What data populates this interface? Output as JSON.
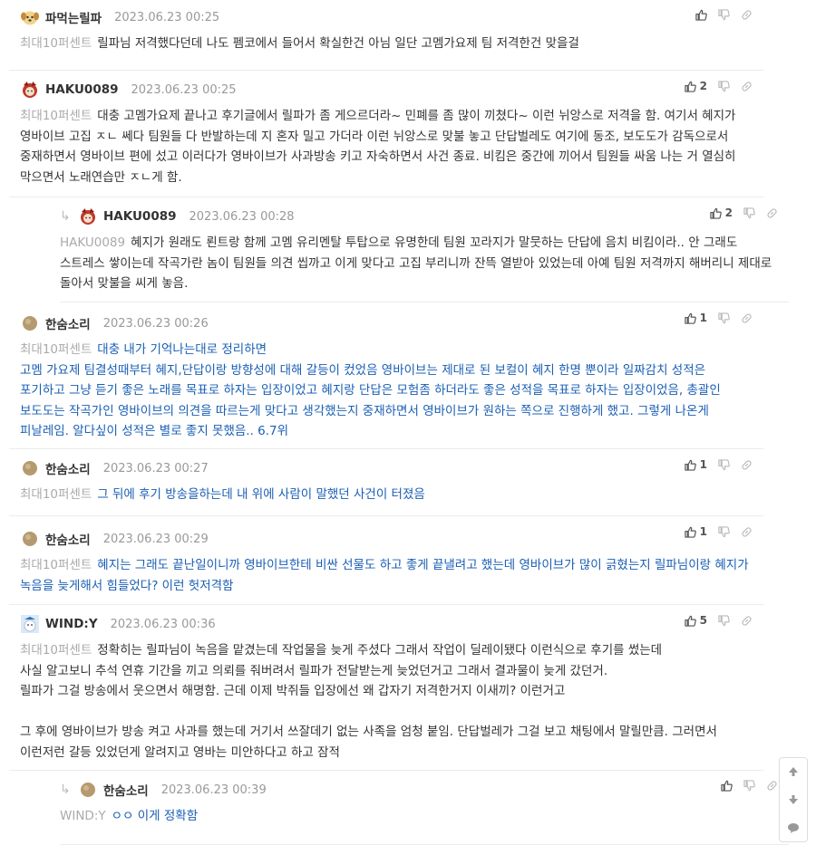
{
  "comments": [
    {
      "nick": "파먹는릴파",
      "date": "2023.06.23 00:25",
      "avatar": "dog-face-icon",
      "likes": "",
      "mention": "최대10퍼센트",
      "text": "릴파님 저격했다던데 나도 펨코에서 들어서 확실한건 아님 일단 고멤가요제 팀 저격한건 맞을걸",
      "blue": false,
      "reply": false
    },
    {
      "nick": "HAKU0089",
      "date": "2023.06.23 00:25",
      "avatar": "red-character-icon",
      "likes": "2",
      "mention": "최대10퍼센트",
      "text": "대충 고멤가요제 끝나고 후기글에서 릴파가 좀 게으르더라~ 민폐를 좀 많이 끼쳤다~ 이런 뉘앙스로 저격을 함. 여기서 혜지가 영바이브 고집 ㅈㄴ 쎄다 팀원들 다 반발하는데 지 혼자 밀고 가더라 이런 뉘앙스로 맞불 놓고 단답벌레도 여기에 동조, 보도도가 감독으로서 중재하면서 영바이브 편에 섰고 이러다가 영바이브가 사과방송 키고 자숙하면서 사건 종료. 비킴은 중간에 끼어서 팀원들 싸움 나는 거 열심히 막으면서 노래연습만 ㅈㄴ게 함.",
      "blue": false,
      "reply": false
    },
    {
      "nick": "HAKU0089",
      "date": "2023.06.23 00:28",
      "avatar": "red-character-icon",
      "likes": "2",
      "mention": "HAKU0089",
      "text": "혜지가 원래도 뢴트랑 함께 고멤 유리멘탈 투탑으로 유명한데 팀원 꼬라지가 말뭇하는 단답에 음치 비킴이라.. 안 그래도 스트레스 쌓이는데 작곡가란 놈이 팀원들 의견 씹까고 이게 맞다고 고집 부리니까 잔뜩 열받아 있었는데 아예 팀원 저격까지 해버리니 제대로 돌아서 맞불을 씨게 놓음.",
      "blue": false,
      "reply": true
    },
    {
      "nick": "한숨소리",
      "date": "2023.06.23 00:26",
      "avatar": "circle-avatar-icon",
      "likes": "1",
      "mention": "최대10퍼센트",
      "text": "대충 내가 기억나는대로 정리하면\n고멤 가요제 팀결성때부터 혜지,단답이랑 방향성에 대해 갈등이 컸었음 영바이브는 제대로 된 보컬이 혜지 한명 뿐이라 일짜감치 성적은 포기하고 그냥 듣기 좋은 노래를 목표로 하자는 입장이었고 혜지랑 단답은 모험좀 하더라도 좋은 성적을 목표로 하자는 입장이었음, 총괄인 보도도는 작곡가인 영바이브의 의견을 따르는게 맞다고 생각했는지 중재하면서 영바이브가 원하는 쪽으로 진행하게 했고. 그렇게 나온게 피날레임. 알다싶이 성적은 별로 좋지 못했음.. 6.7위",
      "blue": true,
      "reply": false
    },
    {
      "nick": "한숨소리",
      "date": "2023.06.23 00:27",
      "avatar": "circle-avatar-icon",
      "likes": "1",
      "mention": "최대10퍼센트",
      "text": "그 뒤에 후기 방송을하는데 내 위에 사람이 말했던 사건이 터졌음",
      "blue": true,
      "reply": false
    },
    {
      "nick": "한숨소리",
      "date": "2023.06.23 00:29",
      "avatar": "circle-avatar-icon",
      "likes": "1",
      "mention": "최대10퍼센트",
      "text": "혜지는 그래도 끝난일이니까 영바이브한테 비싼 선물도 하고 좋게 끝낼려고 했는데 영바이브가 많이 긁혔는지 릴파님이랑 혜지가 녹음을 늦게해서 힘들었다? 이런 헛저격함",
      "blue": true,
      "reply": false
    },
    {
      "nick": "WIND:Y",
      "date": "2023.06.23 00:36",
      "avatar": "snowman-icon",
      "likes": "5",
      "mention": "최대10퍼센트",
      "text": "정확히는 릴파님이 녹음을 맡겼는데 작업물을 늦게 주셨다 그래서 작업이 딜레이됐다 이런식으로 후기를 썼는데\n사실 알고보니 추석 연휴 기간을 끼고 의뢰를 줘버려서 릴파가 전달받는게 늦었던거고 그래서 결과물이 늦게 갔던거.\n릴파가 그걸 방송에서 웃으면서 해명함. 근데 이제 박쥐들 입장에선 왜 갑자기 저격한거지 이새끼? 이런거고\n\n그 후에 영바이브가 방송 켜고 사과를 했는데 거기서 쓰잘데기 없는 사족을 엄청 붙임. 단답벌레가 그걸 보고 채팅에서 말릴만큼. 그러면서 이런저런 갈등 있었던게 알려지고 영바는 미안하다고 하고 잠적",
      "blue": false,
      "reply": false
    },
    {
      "nick": "한숨소리",
      "date": "2023.06.23 00:39",
      "avatar": "circle-avatar-icon",
      "likes": "",
      "mention": "WIND:Y",
      "text": "ㅇㅇ 이게 정확함",
      "blue": true,
      "reply": true
    }
  ],
  "scroll": {
    "up_icon": "arrow-up-icon",
    "down_icon": "arrow-down-icon",
    "comment_icon": "speech-bubble-icon"
  },
  "colors": {
    "link_blue": "#1a5fb4",
    "mention_gray": "#aaaaaa",
    "date_gray": "#999999"
  }
}
